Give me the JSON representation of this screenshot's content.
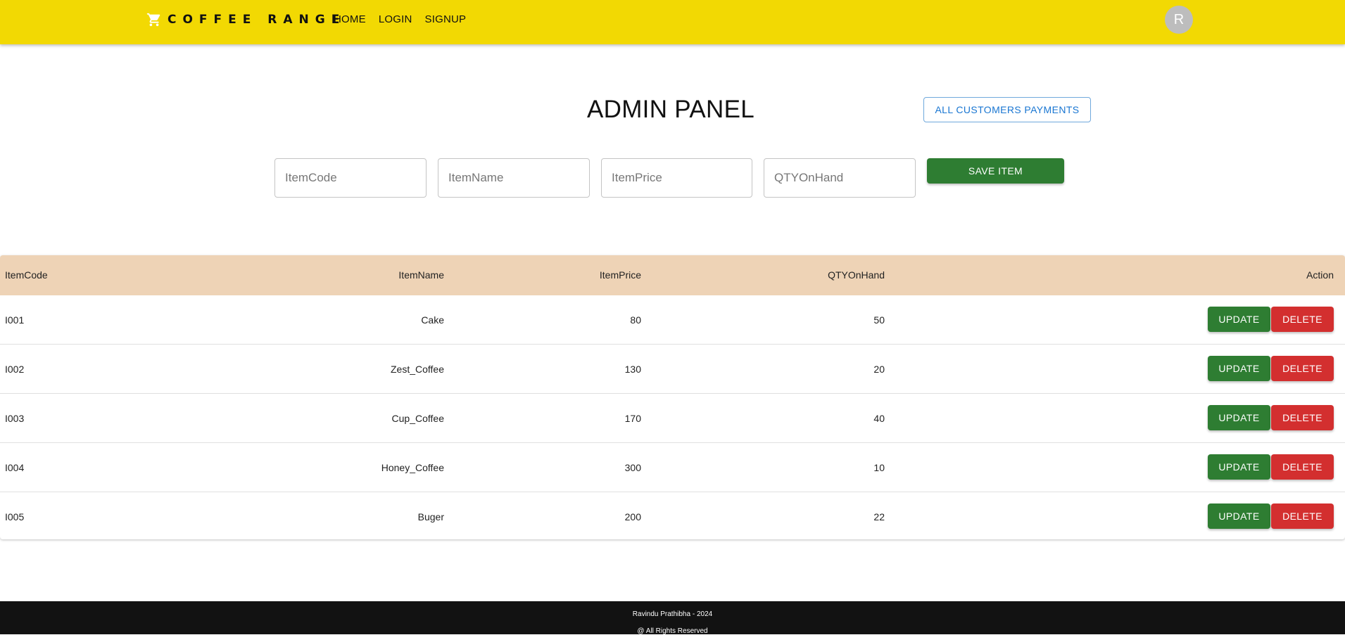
{
  "header": {
    "brand": "COFFEE RANGE",
    "nav": [
      "HOME",
      "LOGIN",
      "SIGNUP"
    ],
    "avatar_letter": "R",
    "icons": {
      "brand": "cart-icon"
    },
    "colors": {
      "bar": "#f2d903"
    }
  },
  "main": {
    "title": "ADMIN PANEL",
    "payments_button": "ALL CUSTOMERS PAYMENTS",
    "form": {
      "placeholders": [
        "ItemCode",
        "ItemName",
        "ItemPrice",
        "QTYOnHand"
      ],
      "save_button": "SAVE ITEM"
    }
  },
  "table": {
    "headers": [
      "ItemCode",
      "ItemName",
      "ItemPrice",
      "QTYOnHand",
      "Action"
    ],
    "rows": [
      {
        "code": "I001",
        "name": "Cake",
        "price": "80",
        "qty": "50"
      },
      {
        "code": "I002",
        "name": "Zest_Coffee",
        "price": "130",
        "qty": "20"
      },
      {
        "code": "I003",
        "name": "Cup_Coffee",
        "price": "170",
        "qty": "40"
      },
      {
        "code": "I004",
        "name": "Honey_Coffee",
        "price": "300",
        "qty": "10"
      },
      {
        "code": "I005",
        "name": "Buger",
        "price": "200",
        "qty": "22"
      }
    ],
    "update_label": "UPDATE",
    "delete_label": "DELETE",
    "colors": {
      "header": "#eed3b6",
      "update": "#2e7d32",
      "delete": "#d32f2f"
    }
  },
  "footer": {
    "line1": "Ravindu Prathibha - 2024",
    "line2": "@ All Rights Reserved"
  }
}
